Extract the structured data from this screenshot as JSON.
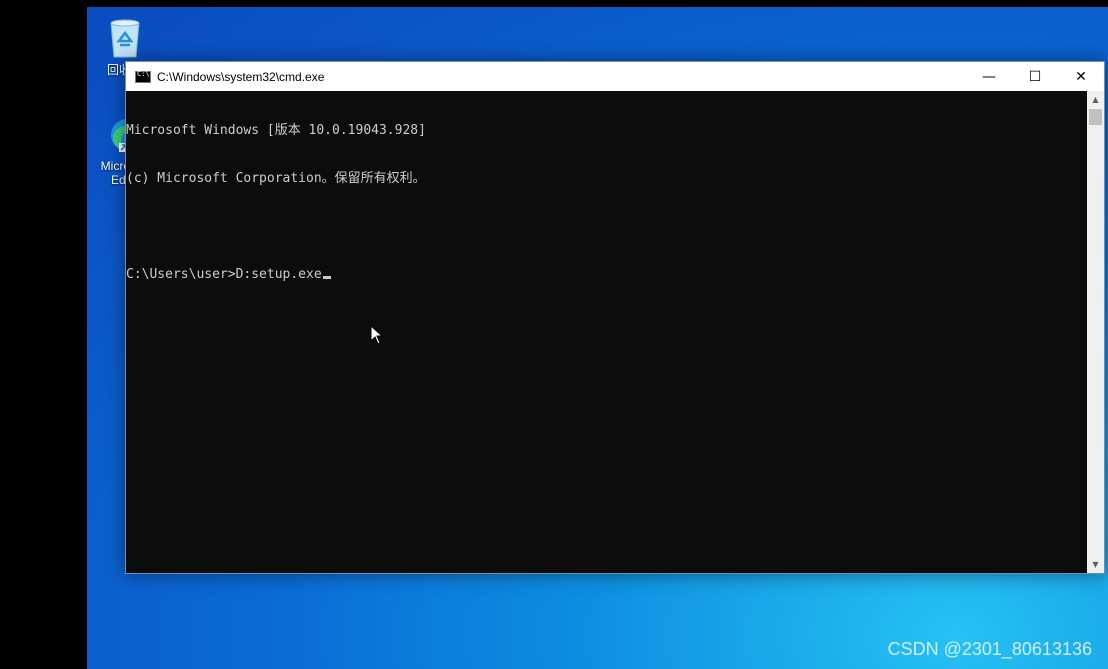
{
  "desktop": {
    "icons": [
      {
        "label": "回收站",
        "icon": "recycle-bin-icon"
      },
      {
        "label": "Microsoft Edge",
        "icon": "edge-icon"
      }
    ],
    "watermark": "CSDN @2301_80613136"
  },
  "window": {
    "title": "C:\\Windows\\system32\\cmd.exe",
    "icon": "cmd-icon",
    "buttons": {
      "minimize": "—",
      "maximize": "☐",
      "close": "✕"
    }
  },
  "console": {
    "lines": [
      "Microsoft Windows [版本 10.0.19043.928]",
      "(c) Microsoft Corporation。保留所有权利。",
      "",
      "C:\\Users\\user>D:setup.exe"
    ]
  },
  "colors": {
    "console_bg": "#0c0c0c",
    "console_text": "#cccccc",
    "desktop_accent": "#0a6cd6"
  }
}
